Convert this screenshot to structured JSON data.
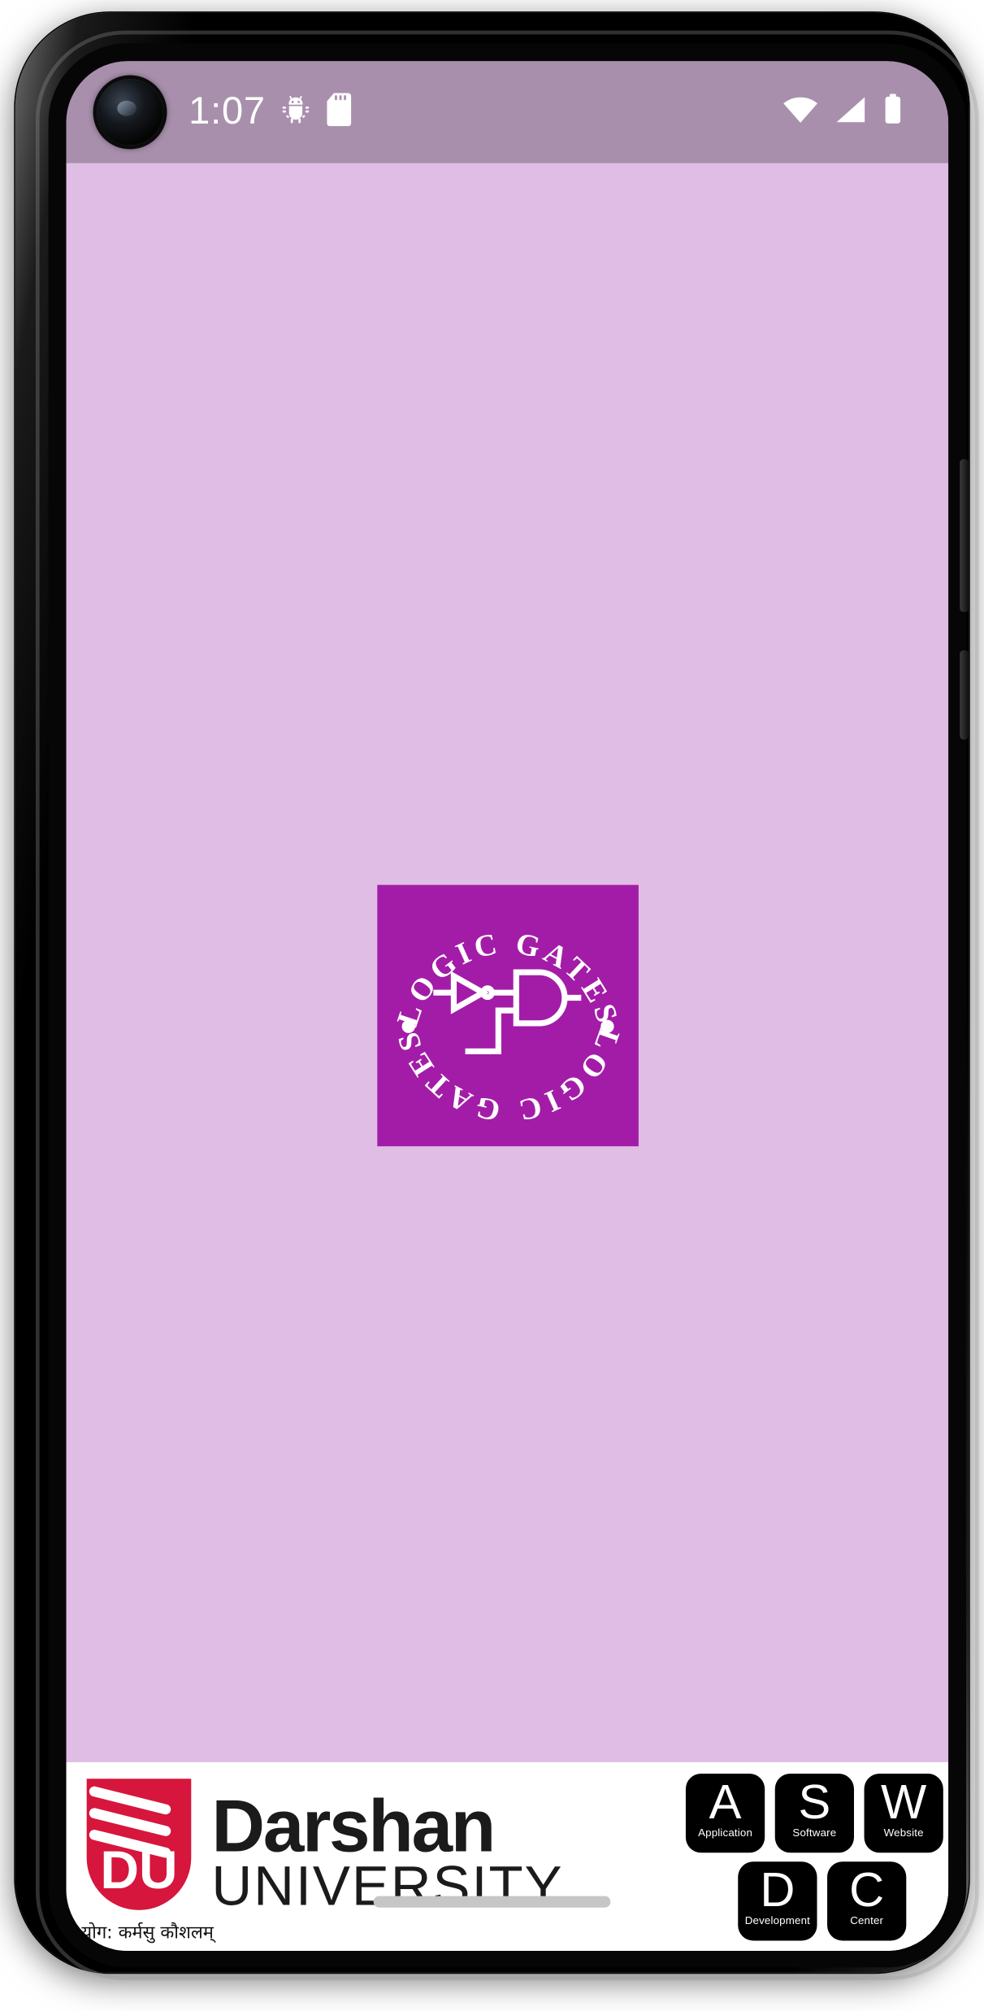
{
  "device": {
    "kind": "android-phone-frame",
    "buttons": [
      {
        "name": "volume-rocker"
      },
      {
        "name": "power-button"
      }
    ]
  },
  "status_bar": {
    "time": "1:07",
    "bg_color": "#A88FAC",
    "text_color": "#FFFFFF",
    "left_icons": [
      {
        "name": "android-debug-icon",
        "label": ""
      },
      {
        "name": "sd-card-icon",
        "label": ""
      }
    ],
    "right_icons": [
      {
        "name": "wifi-icon",
        "label": ""
      },
      {
        "name": "cell-signal-icon",
        "label": ""
      },
      {
        "name": "battery-full-icon",
        "label": ""
      }
    ]
  },
  "screen": {
    "background_color": "#E0BDE4"
  },
  "splash": {
    "app_logo": {
      "name": "logic-gates-app-logo",
      "background_color": "#A31CA8",
      "foreground_color": "#FFFFFF",
      "ring_text_top": "LOGIC GATES",
      "ring_text_bottom": "LOGIC GATES",
      "center_symbol": "not-and-gate-diagram"
    }
  },
  "footer": {
    "background_color": "#FFFFFF",
    "university": {
      "emblem_color": "#D6163C",
      "emblem_monogram": "DU",
      "name_line1": "Darshan",
      "name_line2": "UNIVERSITY",
      "tagline": "योग: कर्मसु कौशलम्"
    },
    "aswdc": {
      "badge_bg": "#000000",
      "badge_fg": "#FFFFFF",
      "row1": [
        {
          "letter": "A",
          "word": "Application"
        },
        {
          "letter": "S",
          "word": "Software"
        },
        {
          "letter": "W",
          "word": "Website"
        }
      ],
      "row2": [
        {
          "letter": "D",
          "word": "Development"
        },
        {
          "letter": "C",
          "word": "Center"
        }
      ]
    }
  },
  "navigation": {
    "gesture_pill": {
      "name": "home-gesture-pill",
      "color": "#C6C6C6"
    }
  }
}
